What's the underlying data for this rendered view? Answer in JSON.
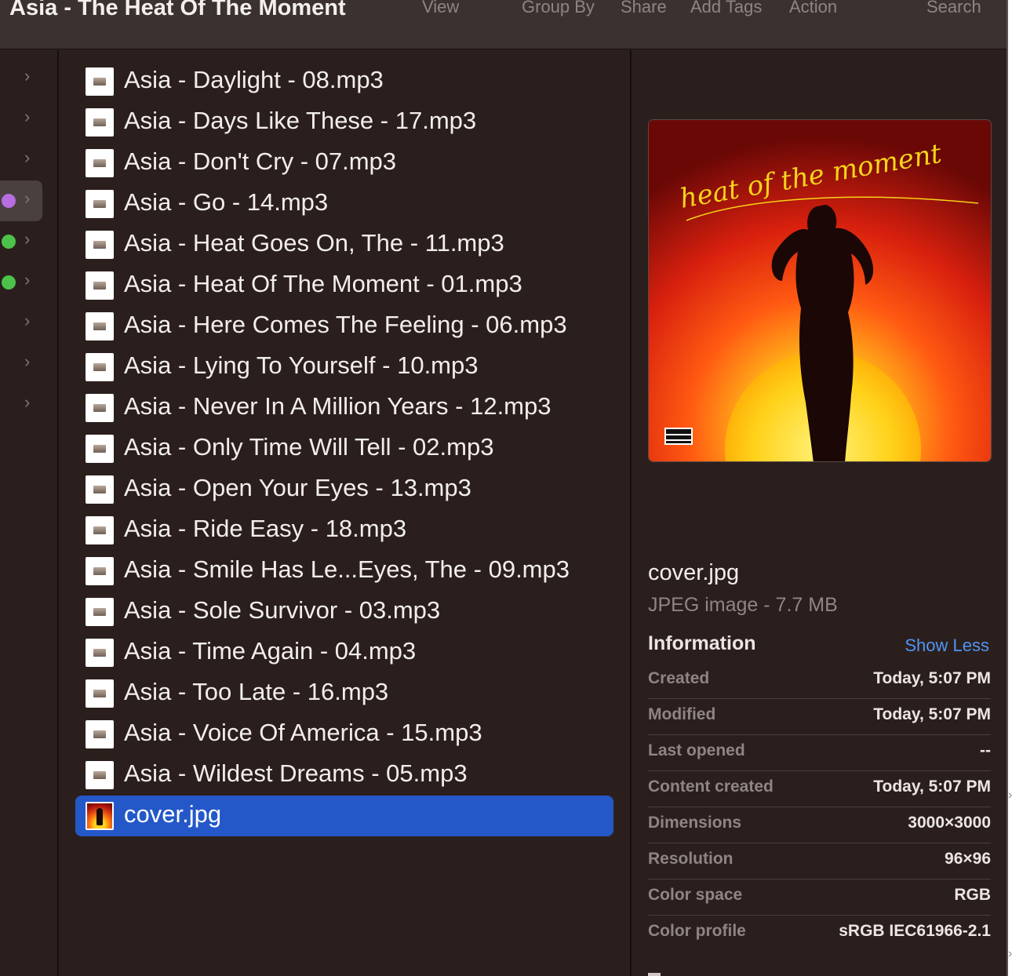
{
  "window": {
    "title": "Asia - The Heat Of The Moment"
  },
  "toolbar": {
    "view": "View",
    "group_by": "Group By",
    "share": "Share",
    "add_tags": "Add Tags",
    "action": "Action",
    "search": "Search"
  },
  "left_column": {
    "rows": [
      {
        "tag_color": null,
        "highlighted": false
      },
      {
        "tag_color": null,
        "highlighted": false
      },
      {
        "tag_color": null,
        "highlighted": false
      },
      {
        "tag_color": "#b86ee0",
        "highlighted": true
      },
      {
        "tag_color": "#4cc24a",
        "highlighted": false
      },
      {
        "tag_color": "#4cc24a",
        "highlighted": false
      },
      {
        "tag_color": null,
        "highlighted": false
      },
      {
        "tag_color": null,
        "highlighted": false
      },
      {
        "tag_color": null,
        "highlighted": false
      }
    ],
    "chevron_icon": "chevron-right-icon"
  },
  "files": [
    {
      "name": "Asia - Daylight - 08.mp3",
      "icon": "audio-file-icon",
      "selected": false
    },
    {
      "name": "Asia - Days Like These - 17.mp3",
      "icon": "audio-file-icon",
      "selected": false
    },
    {
      "name": "Asia - Don't Cry - 07.mp3",
      "icon": "audio-file-icon",
      "selected": false
    },
    {
      "name": "Asia - Go - 14.mp3",
      "icon": "audio-file-icon",
      "selected": false
    },
    {
      "name": "Asia - Heat Goes On, The - 11.mp3",
      "icon": "audio-file-icon",
      "selected": false
    },
    {
      "name": "Asia - Heat Of The Moment - 01.mp3",
      "icon": "audio-file-icon",
      "selected": false
    },
    {
      "name": "Asia - Here Comes The Feeling - 06.mp3",
      "icon": "audio-file-icon",
      "selected": false
    },
    {
      "name": "Asia - Lying To Yourself - 10.mp3",
      "icon": "audio-file-icon",
      "selected": false
    },
    {
      "name": "Asia - Never In A Million Years - 12.mp3",
      "icon": "audio-file-icon",
      "selected": false
    },
    {
      "name": "Asia - Only Time Will Tell - 02.mp3",
      "icon": "audio-file-icon",
      "selected": false
    },
    {
      "name": "Asia - Open Your Eyes - 13.mp3",
      "icon": "audio-file-icon",
      "selected": false
    },
    {
      "name": "Asia - Ride Easy - 18.mp3",
      "icon": "audio-file-icon",
      "selected": false
    },
    {
      "name": "Asia - Smile Has Le...Eyes, The - 09.mp3",
      "icon": "audio-file-icon",
      "selected": false
    },
    {
      "name": "Asia - Sole Survivor - 03.mp3",
      "icon": "audio-file-icon",
      "selected": false
    },
    {
      "name": "Asia - Time Again - 04.mp3",
      "icon": "audio-file-icon",
      "selected": false
    },
    {
      "name": "Asia - Too Late - 16.mp3",
      "icon": "audio-file-icon",
      "selected": false
    },
    {
      "name": "Asia - Voice Of America - 15.mp3",
      "icon": "audio-file-icon",
      "selected": false
    },
    {
      "name": "Asia - Wildest Dreams - 05.mp3",
      "icon": "audio-file-icon",
      "selected": false
    },
    {
      "name": "cover.jpg",
      "icon": "image-file-icon",
      "selected": true
    }
  ],
  "preview": {
    "artwork_text": "heat of the moment",
    "artwork_icon": "album-artwork-image",
    "file_name": "cover.jpg",
    "file_type": "JPEG image - 7.7 MB",
    "info_heading": "Information",
    "show_less": "Show Less",
    "info": [
      {
        "label": "Created",
        "value": "Today, 5:07 PM"
      },
      {
        "label": "Modified",
        "value": "Today, 5:07 PM"
      },
      {
        "label": "Last opened",
        "value": "--"
      },
      {
        "label": "Content created",
        "value": "Today, 5:07 PM"
      },
      {
        "label": "Dimensions",
        "value": "3000×3000"
      },
      {
        "label": "Resolution",
        "value": "96×96"
      },
      {
        "label": "Color space",
        "value": "RGB"
      },
      {
        "label": "Color profile",
        "value": "sRGB IEC61966-2.1"
      }
    ]
  },
  "colors": {
    "background": "#2b1f1d",
    "selection": "#2458c9",
    "link": "#4f95f5",
    "secondary_text": "#8f8583"
  }
}
